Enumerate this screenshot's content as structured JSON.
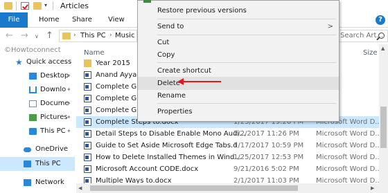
{
  "window": {
    "title": "Articles"
  },
  "ribbon": {
    "tabs": [
      "File",
      "Home",
      "Share",
      "View"
    ]
  },
  "address": {
    "segments": [
      "This PC",
      "Music ("
    ],
    "search_placeholder": "Search Art..."
  },
  "watermark": "©Howtoconnect",
  "nav": {
    "items": [
      {
        "label": "Quick access",
        "icon": "star-icon",
        "pinned": false
      },
      {
        "label": "Desktop",
        "icon": "desktop-icon",
        "pinned": true
      },
      {
        "label": "Downlo",
        "icon": "download-icon",
        "pinned": true
      },
      {
        "label": "Docume",
        "icon": "documents-icon",
        "pinned": true
      },
      {
        "label": "Pictures",
        "icon": "pictures-icon",
        "pinned": true
      },
      {
        "label": "This PC",
        "icon": "pc-icon",
        "pinned": true
      },
      {
        "label": "OneDrive",
        "icon": "cloud-icon",
        "pinned": false
      },
      {
        "label": "This PC",
        "icon": "pc-icon",
        "pinned": false
      },
      {
        "label": "Network",
        "icon": "network-icon",
        "pinned": false
      }
    ]
  },
  "files": {
    "columns": {
      "name": "Name",
      "size": "Size"
    },
    "rows": [
      {
        "name": "Year 2015",
        "date": "",
        "type": "",
        "icon": "folder"
      },
      {
        "name": "Anand Ayyaga",
        "date": "",
        "type": "",
        "icon": "word"
      },
      {
        "name": "Complete Gui",
        "date": "",
        "type": "",
        "icon": "word"
      },
      {
        "name": "Complete Gui",
        "date": "",
        "type": "",
        "icon": "word"
      },
      {
        "name": "Complete Gui",
        "date": "",
        "type": "",
        "icon": "word"
      },
      {
        "name": "Complete Steps to.docx",
        "date": "1/23/2017 19:20 PM",
        "type": "Microsoft Word D...",
        "icon": "word"
      },
      {
        "name": "Detail Steps to Disable Enable Mono Audi...",
        "date": "2/2/2017 11:26 PM",
        "type": "Microsoft Word D...",
        "icon": "word"
      },
      {
        "name": "Guide to Set Aside Microsoft Edge Tabs.d",
        "date": "1/17/2017 10:59 PM",
        "type": "Microsoft Word D...",
        "icon": "word"
      },
      {
        "name": "How to Delete Installed Themes in Wind...",
        "date": "1/25/2017 12:53 PM",
        "type": "Microsoft Word D...",
        "icon": "word"
      },
      {
        "name": "Microsoft Account CODE.docx",
        "date": "9/21/2016 5:02 PM",
        "type": "Microsoft Word D...",
        "icon": "word"
      },
      {
        "name": "Multiple Ways to.docx",
        "date": "2/1/2017 11:03 PM",
        "type": "Microsoft Word D...",
        "icon": "word"
      }
    ]
  },
  "context_menu": {
    "items": [
      {
        "label": "Restore previous versions"
      },
      {
        "label": "Send to",
        "submenu": true
      },
      {
        "label": "Cut"
      },
      {
        "label": "Copy"
      },
      {
        "label": "Create shortcut"
      },
      {
        "label": "Delete"
      },
      {
        "label": "Rename"
      },
      {
        "label": "Properties"
      }
    ],
    "submenu_glyph": ">"
  },
  "colors": {
    "accent": "#1979ca",
    "selection": "#cce8ff",
    "arrow": "#e0191e"
  }
}
